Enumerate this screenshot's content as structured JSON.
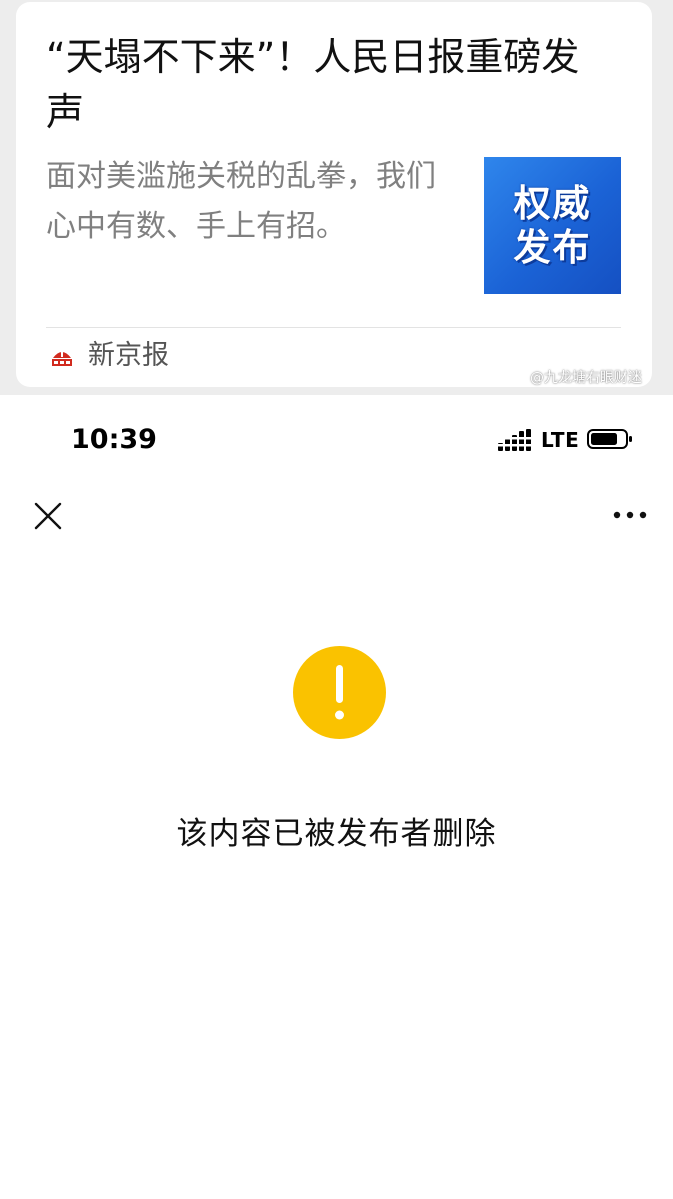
{
  "shared_card": {
    "title": "“天塌不下来”！人民日报重磅发声",
    "description": "面对美滥施关税的乱拳，我们心中有数、手上有招。",
    "thumbnail": {
      "line1": "权威",
      "line2": "发布"
    },
    "source": {
      "name": "新京报",
      "logo_icon": "xinjingbao-logo-icon"
    }
  },
  "watermark": {
    "text": "@九龙塘右眼财迷",
    "icon": "weibo-icon"
  },
  "status_bar": {
    "time": "10:39",
    "network": "LTE",
    "signal_icon": "signal-bars-icon",
    "battery_icon": "battery-icon"
  },
  "nav_bar": {
    "close_icon": "close-icon",
    "more_icon": "more-dots-icon"
  },
  "message": {
    "icon": "warning-icon",
    "text": "该内容已被发布者删除"
  },
  "colors": {
    "warning": "#FAC200",
    "thumbnail_blue": "#1F6BDF",
    "card_background": "#FFFFFF",
    "page_background": "#EDEDED"
  }
}
